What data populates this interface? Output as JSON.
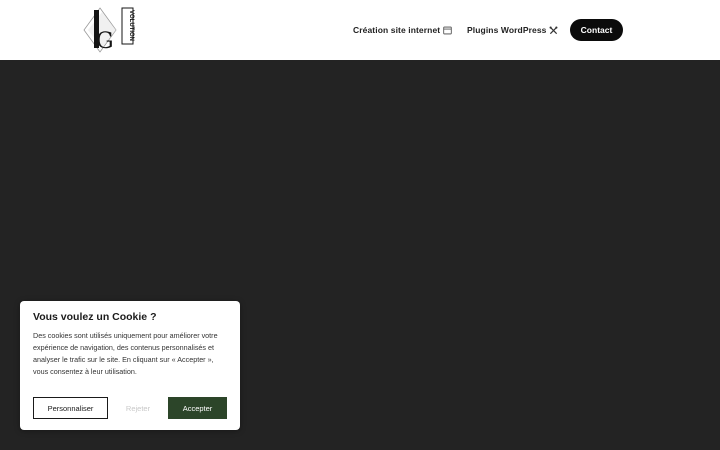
{
  "header": {
    "logo_alt": "VOLUTION",
    "nav": [
      {
        "label": "Création site internet",
        "icon": "browser-window-icon"
      },
      {
        "label": "Plugins WordPress",
        "icon": "tools-icon"
      }
    ],
    "contact_label": "Contact"
  },
  "cookie_banner": {
    "title": "Vous voulez un Cookie ?",
    "text": "Des cookies sont utilisés uniquement pour améliorer votre expérience de navigation, des contenus personnalisés et analyser le trafic sur le site. En cliquant sur « Accepter », vous consentez à leur utilisation.",
    "customize_label": "Personnaliser",
    "reject_label": "Rejeter",
    "accept_label": "Accepter",
    "accept_color": "#2c4529"
  },
  "colors": {
    "hero_background": "#232323",
    "header_background": "#ffffff",
    "contact_button": "#0b0b0b"
  }
}
